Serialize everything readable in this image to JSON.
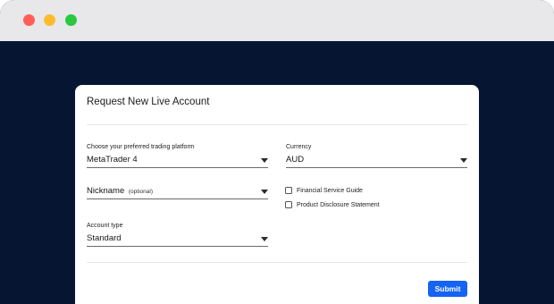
{
  "window": {
    "controls": [
      "close",
      "minimize",
      "maximize"
    ],
    "colors": {
      "close": "#ff5f57",
      "minimize": "#febc2e",
      "maximize": "#28c840",
      "background": "#061632",
      "titlebar": "#e8e8eb"
    }
  },
  "dialog": {
    "title": "Request New Live Account",
    "platform": {
      "label": "Choose your preferred trading platform",
      "value": "MetaTrader 4"
    },
    "currency": {
      "label": "Currency",
      "value": "AUD"
    },
    "nickname": {
      "placeholder": "Nickname",
      "hint": "(optional)"
    },
    "account_type": {
      "label": "Account type",
      "value": "Standard"
    },
    "checkboxes": [
      {
        "label": "Financial Service Guide",
        "checked": false
      },
      {
        "label": "Product Disclosure Statement",
        "checked": false
      }
    ],
    "submit_label": "Submit",
    "accent": "#1463f3"
  }
}
